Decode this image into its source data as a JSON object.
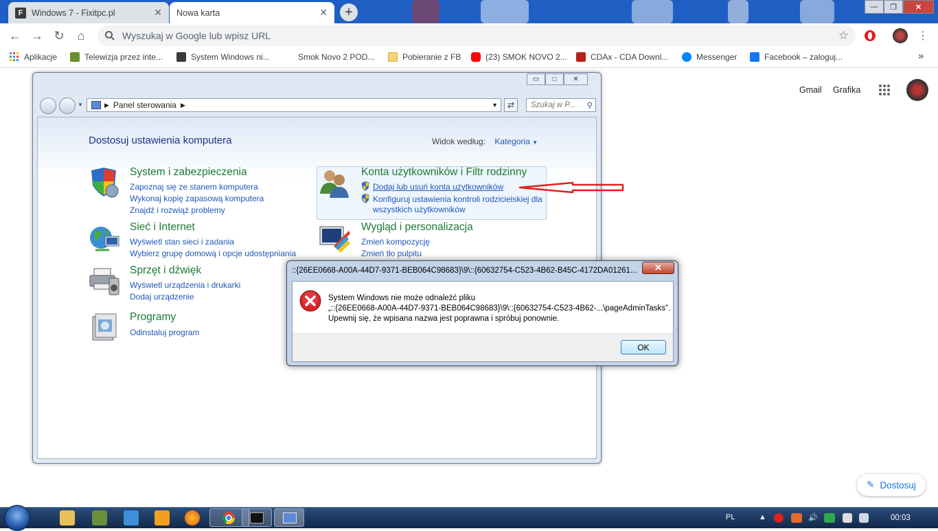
{
  "browser": {
    "tabs": [
      {
        "title": "Windows 7 - Fixitpc.pl",
        "favicon": "F"
      },
      {
        "title": "Nowa karta"
      }
    ],
    "new_tab_symbol": "+",
    "window_controls": {
      "minimize": "—",
      "maximize": "❐",
      "close": "✕"
    },
    "omnibox_placeholder": "Wyszukaj w Google lub wpisz URL",
    "bookmarks": [
      "Aplikacje",
      "Telewizja przez inte...",
      "System Windows ni...",
      "Smok Novo 2 POD...",
      "Pobieranie z FB",
      "(23) SMOK NOVO 2...",
      "CDAx - CDA Downl...",
      "Messenger",
      "Facebook – zaloguj..."
    ],
    "bookmarks_overflow": "»"
  },
  "google": {
    "gmail": "Gmail",
    "images": "Grafika",
    "customize": "Dostosuj"
  },
  "control_panel": {
    "window_controls": {
      "minimize": "▭",
      "maximize": "□",
      "close": "✕"
    },
    "breadcrumb": "Panel sterowania",
    "search_placeholder": "Szukaj w P...",
    "title": "Dostosuj ustawienia komputera",
    "view_by_label": "Widok według:",
    "view_by_value": "Kategoria",
    "categories": [
      {
        "heading": "System i zabezpieczenia",
        "links": [
          "Zapoznaj się ze stanem komputera",
          "Wykonaj kopię zapasową komputera",
          "Znajdź i rozwiąż problemy"
        ]
      },
      {
        "heading": "Sieć i Internet",
        "links": [
          "Wyświetl stan sieci i zadania",
          "Wybierz grupę domową i opcje udostępniania"
        ]
      },
      {
        "heading": "Sprzęt i dźwięk",
        "links": [
          "Wyświetl urządzenia i drukarki",
          "Dodaj urządzenie"
        ]
      },
      {
        "heading": "Programy",
        "links": [
          "Odinstaluj program"
        ]
      },
      {
        "heading": "Konta użytkowników i Filtr rodzinny",
        "links": [
          "Dodaj lub usuń konta użytkowników",
          "Konfiguruj ustawienia kontroli rodzicielskiej dla",
          "wszystkich użytkowników"
        ]
      },
      {
        "heading": "Wygląd i personalizacja",
        "links": [
          "Zmień kompozycję",
          "Zmień tło pulpitu"
        ]
      }
    ]
  },
  "error_dialog": {
    "title": "::{26EE0668-A00A-44D7-9371-BEB064C98683}\\9\\::{60632754-C523-4B62-B45C-4172DA01261...",
    "message_lines": [
      "System Windows nie może odnaleźć pliku",
      "„::{26EE0668-A00A-44D7-9371-BEB064C98683}\\9\\::{60632754-C523-4B62-...\\pageAdminTasks\".",
      "Upewnij się, że wpisana nazwa jest poprawna i spróbuj ponownie."
    ],
    "ok_label": "OK",
    "close_symbol": "✕"
  },
  "taskbar": {
    "language": "PL",
    "clock": "00:03"
  },
  "colors": {
    "link_blue": "#1f57b8",
    "category_green": "#1c7a34",
    "annotation_red": "#e02020"
  }
}
